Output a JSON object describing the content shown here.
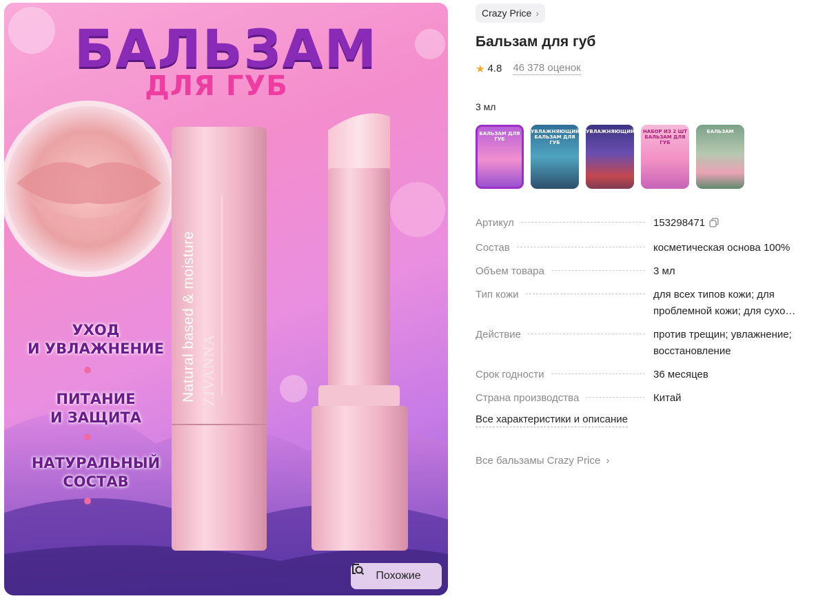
{
  "hero": {
    "title": "БАЛЬЗАМ",
    "subtitle": "ДЛЯ ГУБ",
    "product_text": "Natural based & moisture",
    "product_logo": "ZIVANNA",
    "features": [
      [
        "УХОД",
        "И УВЛАЖНЕНИЕ"
      ],
      [
        "ПИТАНИЕ",
        "И ЗАЩИТА"
      ],
      [
        "НАТУРАЛЬНЫЙ",
        "СОСТАВ"
      ]
    ],
    "similar_button": "Похожие"
  },
  "brand": {
    "name": "Crazy Price",
    "chevron": "›"
  },
  "product": {
    "title": "Бальзам для губ",
    "rating": "4.8",
    "reviews": "46 378 оценок",
    "volume_label": "3 мл"
  },
  "variants": [
    {
      "label": "БАЛЬЗАМ ДЛЯ ГУБ",
      "color": "#c776e0",
      "selected": true
    },
    {
      "label": "УВЛАЖНЯЮЩИЙ БАЛЬЗАМ ДЛЯ ГУБ",
      "color": "#3a7ea8"
    },
    {
      "label": "УВЛАЖНЯЮЩИЙ",
      "color": "#4a3b8c"
    },
    {
      "label": "НАБОР ИЗ 2 ШТ БАЛЬЗАМ ДЛЯ ГУБ",
      "color": "#f2a6cf"
    },
    {
      "label": "БАЛЬЗАМ",
      "color": "#7fa08a"
    }
  ],
  "specs": [
    {
      "name": "Артикул",
      "value": "153298471"
    },
    {
      "name": "Состав",
      "value": "косметическая основа 100%"
    },
    {
      "name": "Объем товара",
      "value": "3 мл"
    },
    {
      "name": "Тип кожи",
      "value": "для всех типов кожи; для",
      "value2": "проблемной кожи; для сухо…"
    },
    {
      "name": "Действие",
      "value": "против трещин; увлажнение;",
      "value2": "восстановление"
    },
    {
      "name": "Срок годности",
      "value": "36 месяцев"
    },
    {
      "name": "Страна производства",
      "value": "Китай"
    }
  ],
  "links": {
    "all_specs": "Все характеристики и описание",
    "all_brand": "Все бальзамы Crazy Price",
    "all_brand_chevron": "›"
  },
  "icons": {
    "star": "star-icon",
    "copy": "copy-icon",
    "similar": "image-search-icon",
    "chevron": "chevron-right-icon"
  },
  "colors": {
    "accent": "#9b30c7",
    "star": "#f5a623",
    "muted_text": "#8a8a8e",
    "text": "#242424"
  }
}
